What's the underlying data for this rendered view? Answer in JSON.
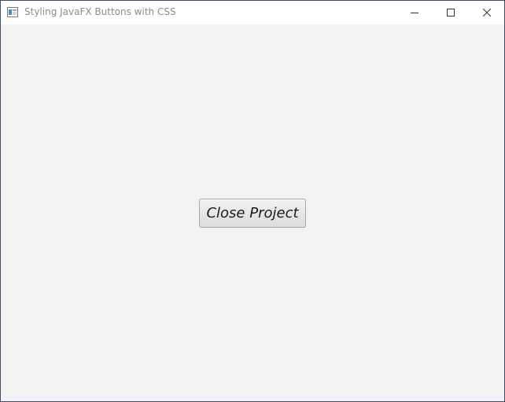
{
  "window": {
    "title": "Styling JavaFX Buttons with CSS",
    "controls": {
      "minimize_icon": "minimize-icon",
      "maximize_icon": "maximize-icon",
      "close_icon": "close-icon"
    }
  },
  "main": {
    "button_label": "Close Project"
  },
  "colors": {
    "titlebar_bg": "#ffffff",
    "content_bg": "#f3f3f3",
    "title_text": "#8c8c8c",
    "button_border": "#a8a8a8"
  }
}
